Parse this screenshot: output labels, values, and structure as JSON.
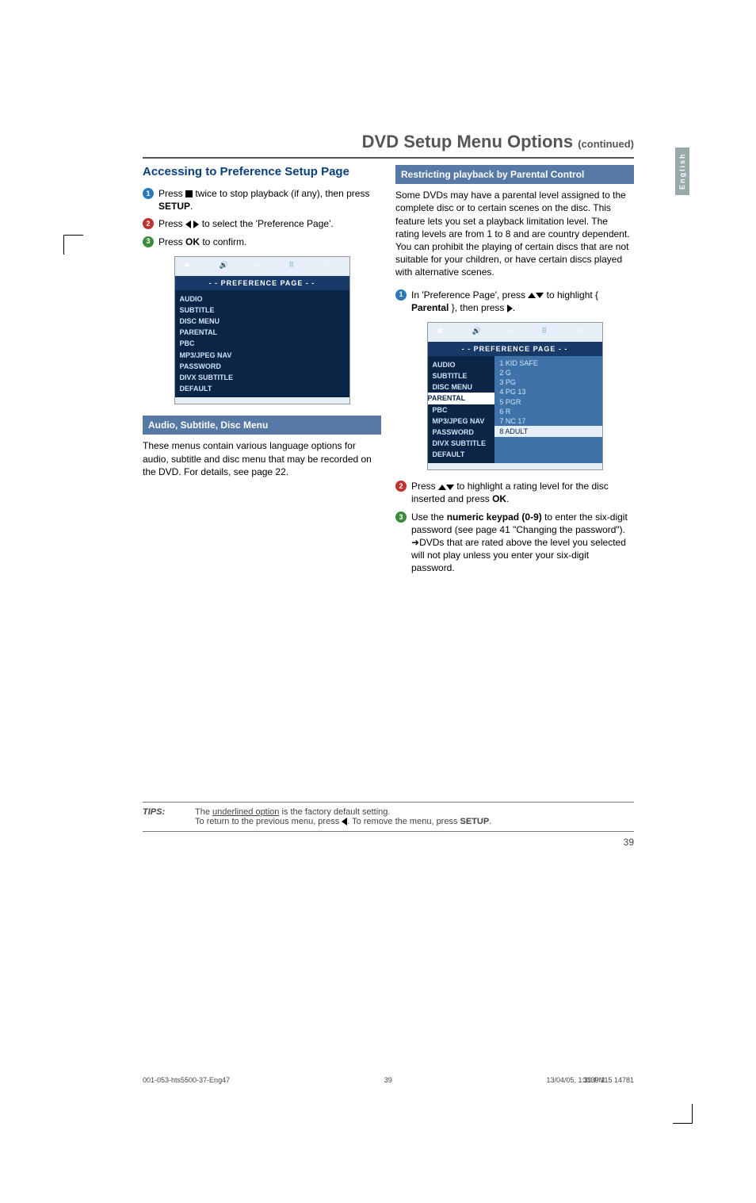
{
  "page": {
    "title_main": "DVD Setup Menu Options ",
    "title_cont": "(continued)",
    "side_tab": "English",
    "page_number": "39"
  },
  "left": {
    "heading": "Accessing to Preference Setup Page",
    "step1_a": "Press ",
    "step1_b": " twice to stop playback (if any), then press ",
    "step1_c": ".",
    "setup_bold": "SETUP",
    "step2_a": "Press ",
    "step2_b": " to select the 'Preference Page'.",
    "step3_a": "Press ",
    "step3_b": " to confirm.",
    "ok_bold": "OK",
    "osd_header": "- -  PREFERENCE  PAGE  - -",
    "osd_items": [
      "AUDIO",
      "SUBTITLE",
      "DISC MENU",
      "PARENTAL",
      "PBC",
      "MP3/JPEG NAV",
      "PASSWORD",
      "DIVX SUBTITLE",
      "DEFAULT"
    ],
    "sub_heading": "Audio, Subtitle, Disc Menu",
    "sub_body": "These menus contain various language options for audio, subtitle and disc menu that may be recorded on the DVD.  For details, see page 22."
  },
  "right": {
    "heading": "Restricting playback by Parental Control",
    "intro": "Some DVDs may have a parental level assigned to the complete disc or to certain scenes on the disc.  This feature lets you set a playback limitation level.  The rating levels are from 1 to 8 and are country dependent.  You can prohibit the playing of certain discs that are not suitable for your children, or have certain discs played with alternative scenes.",
    "step1_a": "In 'Preference Page', press ",
    "step1_b": " to highlight { ",
    "step1_bold": "Parental",
    "step1_c": " }, then press ",
    "step1_d": ".",
    "osd_header": "- -  PREFERENCE  PAGE  - -",
    "osd_left": [
      "AUDIO",
      "SUBTITLE",
      "DISC MENU",
      "PARENTAL",
      "PBC",
      "MP3/JPEG NAV",
      "PASSWORD",
      "DIVX SUBTITLE",
      "DEFAULT"
    ],
    "osd_right": [
      "1  KID SAFE",
      "2  G",
      "3  PG",
      "4  PG 13",
      "5  PGR",
      "6  R",
      "7  NC 17",
      "8  ADULT"
    ],
    "step2_a": "Press ",
    "step2_b": " to highlight a rating level for the disc inserted and press ",
    "step2_c": ".",
    "ok_bold": "OK",
    "step3_a": "Use the ",
    "step3_bold": "numeric keypad (0-9)",
    "step3_b": " to enter the six-digit password (see page 41 \"Changing the password\").",
    "step3_result": "DVDs that are rated above the level you selected will not play unless you enter your six-digit password."
  },
  "tips": {
    "label": "TIPS:",
    "line1_a": "The ",
    "line1_u": "underlined option",
    "line1_b": " is the factory default setting.",
    "line2_a": "To return to the previous menu, press ",
    "line2_b": ".  To remove the menu, press ",
    "line2_bold": "SETUP",
    "line2_c": "."
  },
  "footer": {
    "left": "001-053-hts5500-37-Eng47",
    "center": "39",
    "right_a": "13/04/05, 1:39 PM",
    "right_b": "3139 115 14781"
  }
}
